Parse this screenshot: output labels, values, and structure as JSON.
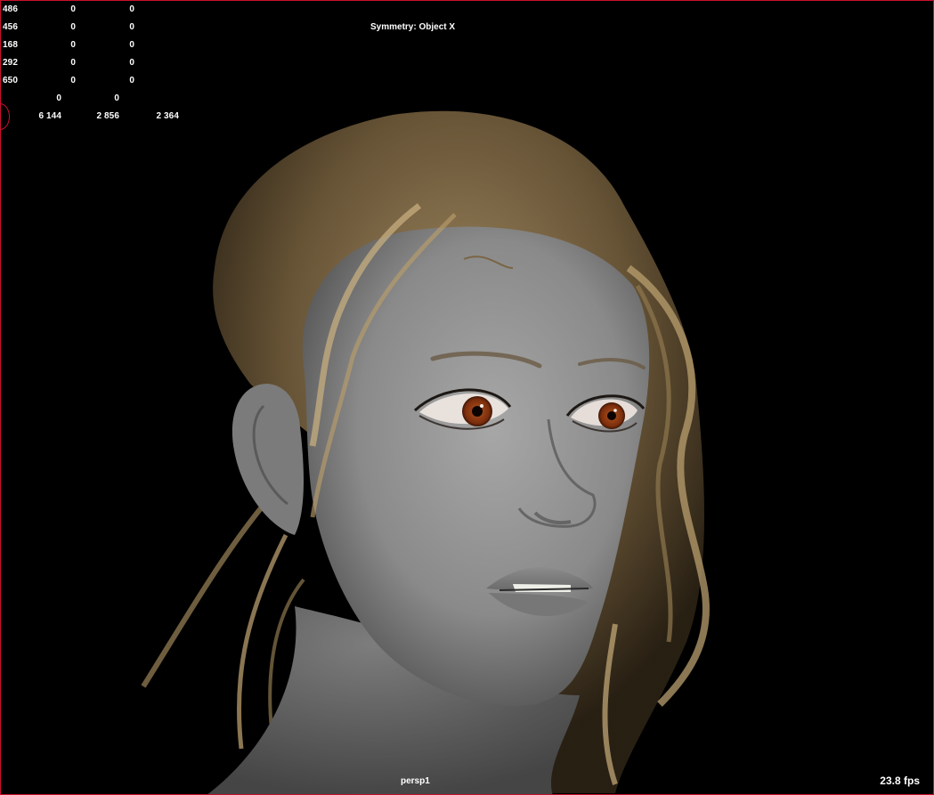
{
  "hud": {
    "rows": [
      {
        "label": "486",
        "a": "0",
        "b": "0"
      },
      {
        "label": "456",
        "a": "0",
        "b": "0"
      },
      {
        "label": "168",
        "a": "0",
        "b": "0"
      },
      {
        "label": "292",
        "a": "0",
        "b": "0"
      },
      {
        "label": "650",
        "a": "0",
        "b": "0"
      }
    ],
    "row6": {
      "a": "0",
      "b": "0"
    },
    "totals": {
      "a": "6 144",
      "b": "2 856",
      "c": "2 364"
    }
  },
  "symmetry_label": "Symmetry: Object X",
  "camera_name": "persp1",
  "fps": "23.8 fps",
  "colors": {
    "viewport_border": "#c8102e",
    "skin": "#8f8f8f",
    "hair": "#a38a62",
    "iris": "#8a3a14"
  }
}
